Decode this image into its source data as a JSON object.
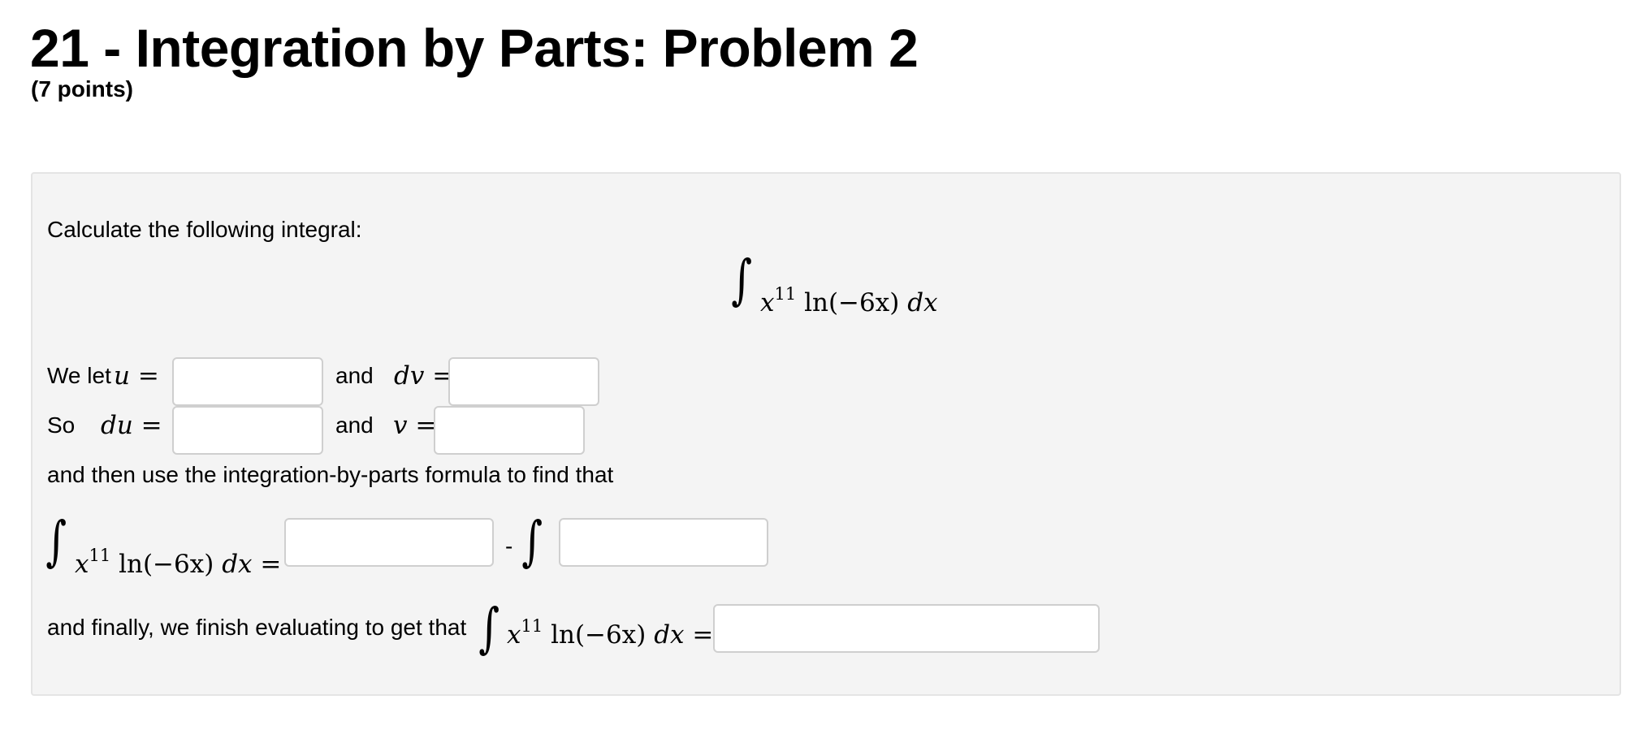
{
  "page": {
    "title": "21 - Integration by Parts: Problem 2",
    "points": "(7 points)"
  },
  "problem": {
    "intro": "Calculate the following integral:",
    "integrand": {
      "var": "x",
      "exponent": "11",
      "log": "ln(−6x)",
      "dx": "dx"
    },
    "line_u": {
      "prefix": "We let",
      "u_var": "u",
      "eq": "=",
      "and": "and",
      "dv_var": "dv",
      "eq2": "="
    },
    "line_du": {
      "prefix": "So",
      "du_var": "du",
      "eq": "=",
      "and": "and",
      "v_var": "v",
      "eq2": "="
    },
    "formula_text": "and then use the integration-by-parts formula to find that",
    "minus": "-",
    "equals": "=",
    "final_text": "and finally, we finish evaluating to get that"
  },
  "inputs": {
    "u": "",
    "dv": "",
    "du": "",
    "v": "",
    "uv_term": "",
    "remaining_integrand": "",
    "final_answer": ""
  }
}
